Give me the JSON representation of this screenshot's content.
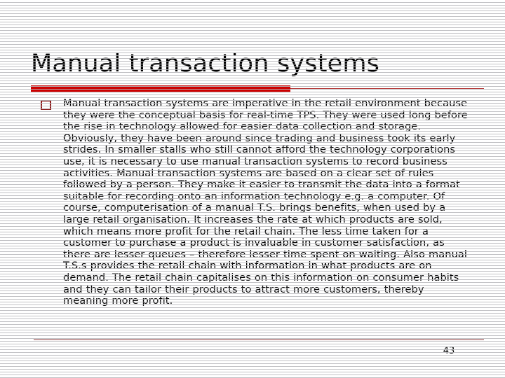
{
  "slide": {
    "title": "Manual transaction systems",
    "page_number": "43",
    "bullets": [
      {
        "marker": "square-outline-bullet",
        "text": "Manual transaction systems are imperative in the retail environment because they were the conceptual basis for real-time TPS. They were used long before the rise in technology allowed for easier data collection and storage. Obviously, they have been around since trading and business took its early strides. In smaller stalls who still cannot afford the technology corporations use, it is necessary to use manual transaction systems to record business activities. Manual transaction systems are based on a clear set of rules followed by a person. They make it easier to transmit the data into a format suitable for recording onto an information technology e.g. a computer. Of course, computerisation of a manual T.S. brings benefits, when used by a large retail organisation. It increases the rate at which products are sold, which means more profit for the retail chain. The less time taken for a customer to purchase a product is invaluable in customer satisfaction, as there are lesser queues – therefore lesser time spent on waiting. Also manual T.S.s provides the retail chain with information in what products are on demand. The retail chain capitalises on this information on consumer habits and they can tailor their products to attract more customers, thereby meaning more profit."
      }
    ]
  },
  "theme": {
    "accent_red": "#cc0000",
    "rule_red": "#b03030",
    "bullet_red": "#8c1a1a",
    "footer_rule": "#8c3a3a",
    "text_color": "#000000",
    "background": "#ffffff",
    "scanline_color": "#b6b6ba"
  }
}
